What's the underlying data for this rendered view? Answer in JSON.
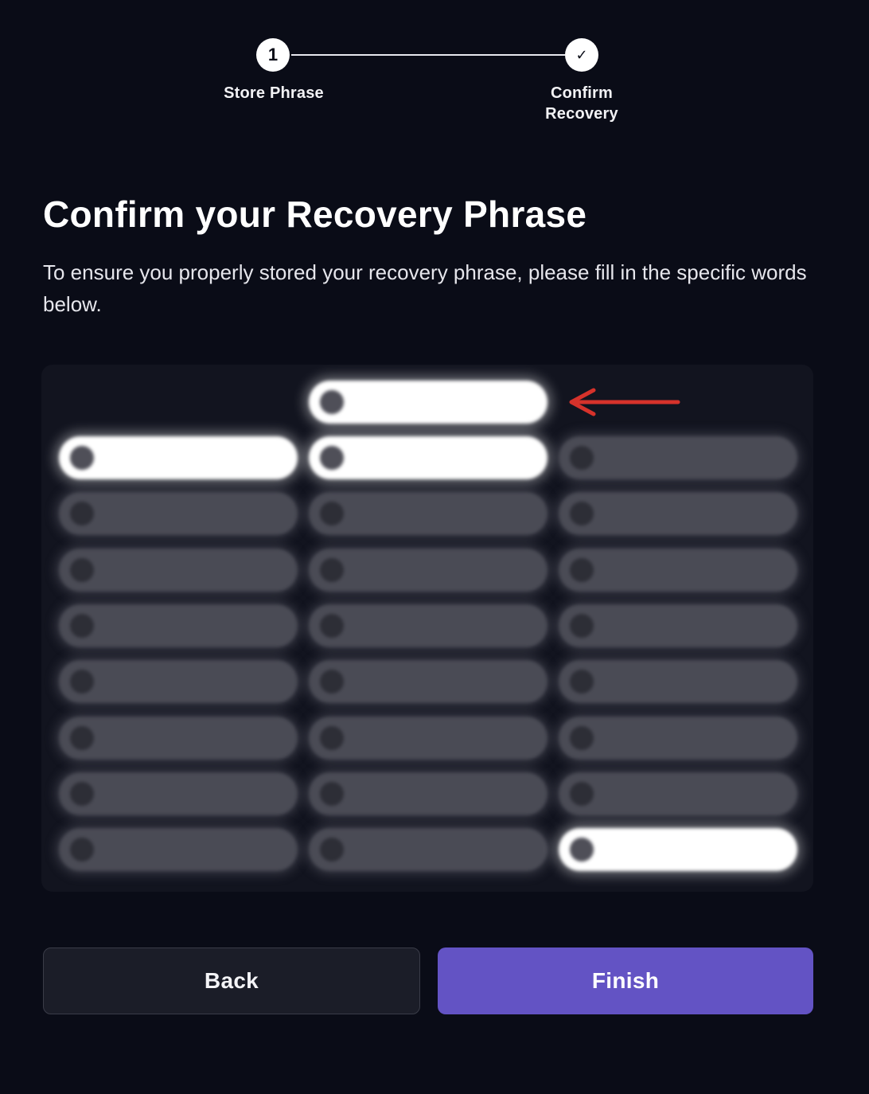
{
  "stepper": {
    "steps": [
      {
        "badge": "1",
        "label": "Store Phrase"
      },
      {
        "badge": "✓",
        "label": "Confirm\nRecovery"
      }
    ]
  },
  "title": "Confirm your Recovery Phrase",
  "description": "To ensure you properly stored your recovery phrase, please fill in the specific words below.",
  "words": {
    "top": {
      "num": "",
      "word": "",
      "selected": true
    },
    "rows": [
      [
        {
          "num": "",
          "word": "",
          "selected": true
        },
        {
          "num": "",
          "word": "",
          "selected": true
        },
        {
          "num": "",
          "word": "",
          "selected": false
        }
      ],
      [
        {
          "num": "",
          "word": "",
          "selected": false
        },
        {
          "num": "",
          "word": "",
          "selected": false
        },
        {
          "num": "",
          "word": "",
          "selected": false
        }
      ],
      [
        {
          "num": "",
          "word": "",
          "selected": false
        },
        {
          "num": "",
          "word": "",
          "selected": false
        },
        {
          "num": "",
          "word": "",
          "selected": false
        }
      ],
      [
        {
          "num": "",
          "word": "",
          "selected": false
        },
        {
          "num": "",
          "word": "",
          "selected": false
        },
        {
          "num": "",
          "word": "",
          "selected": false
        }
      ],
      [
        {
          "num": "",
          "word": "",
          "selected": false
        },
        {
          "num": "",
          "word": "",
          "selected": false
        },
        {
          "num": "",
          "word": "",
          "selected": false
        }
      ],
      [
        {
          "num": "",
          "word": "",
          "selected": false
        },
        {
          "num": "",
          "word": "",
          "selected": false
        },
        {
          "num": "",
          "word": "",
          "selected": false
        }
      ],
      [
        {
          "num": "",
          "word": "",
          "selected": false
        },
        {
          "num": "",
          "word": "",
          "selected": false
        },
        {
          "num": "",
          "word": "",
          "selected": false
        }
      ],
      [
        {
          "num": "",
          "word": "",
          "selected": false
        },
        {
          "num": "",
          "word": "",
          "selected": false
        },
        {
          "num": "",
          "word": "",
          "selected": true
        }
      ]
    ]
  },
  "buttons": {
    "back": "Back",
    "finish": "Finish"
  },
  "colors": {
    "background": "#0a0c17",
    "accent": "#6353c4",
    "annotation_arrow": "#d6322b"
  }
}
